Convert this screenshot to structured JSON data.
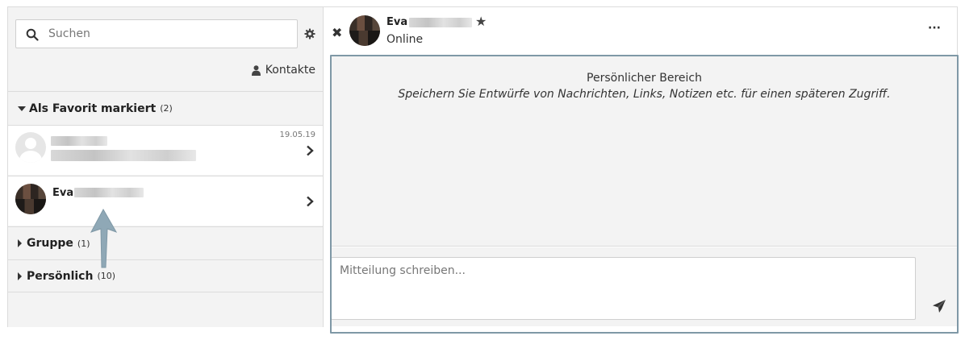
{
  "sidebar": {
    "search_placeholder": "Suchen",
    "contacts_label": "Kontakte",
    "sections": {
      "favorites": {
        "label": "Als Favorit markiert",
        "count": "(2)"
      },
      "group": {
        "label": "Gruppe",
        "count": "(1)"
      },
      "personal": {
        "label": "Persönlich",
        "count": "(10)"
      }
    },
    "favorites": [
      {
        "date": "19.05.19"
      },
      {
        "name": "Eva"
      }
    ]
  },
  "conversation": {
    "contact_name": "Eva",
    "status": "Online",
    "info_title": "Persönlicher Bereich",
    "info_text": "Speichern Sie Entwürfe von Nachrichten, Links, Notizen etc. für einen späteren Zugriff.",
    "compose_placeholder": "Mitteilung schreiben...",
    "more_label": "···"
  },
  "icons": {
    "search": "search-icon",
    "settings": "gear-icon",
    "contacts": "user-icon",
    "favorite": "star-icon",
    "close": "close-icon",
    "send": "paper-plane-icon",
    "chevron": "chevron-right-icon"
  },
  "colors": {
    "highlight_border": "#7f98a6",
    "panel_bg": "#f3f3f3",
    "annotation_arrow": "#7f98a6"
  }
}
